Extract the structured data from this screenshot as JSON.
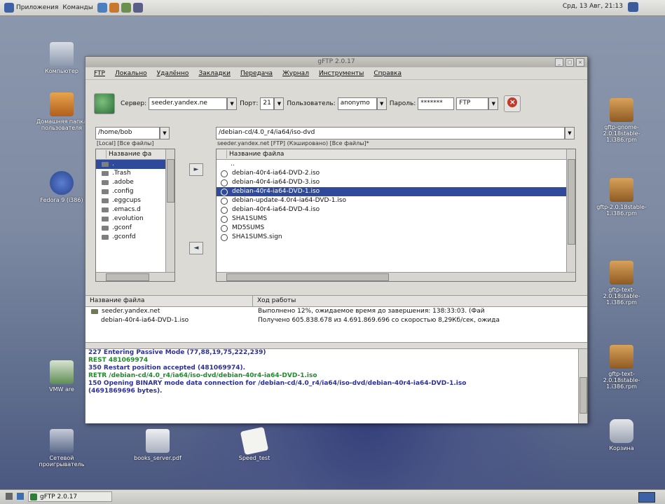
{
  "top_panel": {
    "menu_apps": "Приложения",
    "menu_commands": "Команды",
    "clock": "Срд, 13 Авг, 21:13"
  },
  "desktop_icons": {
    "computer": "Компьютер",
    "home": "Домашняя папка пользователя",
    "fedora": "Fedora 9 (i386)",
    "vmware": "VMW are",
    "network": "Сетевой проигрыватель",
    "pdf": "books_server.pdf",
    "speed": "Speed_test",
    "rpm1": "gftp-gnome-2.0.18stable-1.i386.rpm",
    "rpm2": "gftp-2.0.18stable-1.i386.rpm",
    "rpm3": "gftp-text-2.0.18stable-1.i386.rpm",
    "rpm4": "gftp-text-2.0.18stable-1.i386.rpm",
    "trash": "Корзина"
  },
  "window": {
    "title": "gFTP 2.0.17",
    "menu": [
      "FTP",
      "Локально",
      "Удалённо",
      "Закладки",
      "Передача",
      "Журнал",
      "Инструменты",
      "Справка"
    ],
    "toolbar": {
      "server_label": "Сервер:",
      "server_value": "seeder.yandex.ne",
      "port_label": "Порт:",
      "port_value": "21",
      "user_label": "Пользователь:",
      "user_value": "anonymo",
      "pass_label": "Пароль:",
      "pass_value": "*******",
      "protocol": "FTP"
    },
    "local": {
      "path": "/home/bob",
      "status": "[Local] [Все файлы]",
      "col_name": "Название фа",
      "items": [
        ".",
        ".Trash",
        ".adobe",
        ".config",
        ".eggcups",
        ".emacs.d",
        ".evolution",
        ".gconf",
        ".gconfd"
      ]
    },
    "remote": {
      "path": "/debian-cd/4.0_r4/ia64/iso-dvd",
      "status": "seeder.yandex.net [FTP] (Кэшировано) [Все файлы]*",
      "col_name": "Название файла",
      "items": [
        "..",
        "debian-40r4-ia64-DVD-2.iso",
        "debian-40r4-ia64-DVD-3.iso",
        "debian-40r4-ia64-DVD-1.iso",
        "debian-update-4.0r4-ia64-DVD-1.iso",
        "debian-40r4-ia64-DVD-4.iso",
        "SHA1SUMS",
        "MD5SUMS",
        "SHA1SUMS.sign"
      ]
    },
    "transfer": {
      "col_file": "Название файла",
      "col_progress": "Ход работы",
      "rows": [
        {
          "file": "seeder.yandex.net",
          "progress": "Выполнено 12%, ожидаемое время до завершения: 138:33:03. (Фай"
        },
        {
          "file": "debian-40r4-ia64-DVD-1.iso",
          "progress": "Получено 605.838.678 из 4.691.869.696 со скоростью 8,29Кб/сек, ожида"
        }
      ]
    },
    "log": [
      {
        "text": "227 Entering Passive Mode (77,88,19,75,222,239)",
        "color": "#2b2f9a"
      },
      {
        "text": "REST 481069974",
        "color": "#1f8a2a"
      },
      {
        "text": "350 Restart position accepted (481069974).",
        "color": "#2b2f9a"
      },
      {
        "text": "RETR /debian-cd/4.0_r4/ia64/iso-dvd/debian-40r4-ia64-DVD-1.iso",
        "color": "#1f8a2a"
      },
      {
        "text": "150 Opening BINARY mode data connection for /debian-cd/4.0_r4/ia64/iso-dvd/debian-40r4-ia64-DVD-1.iso",
        "color": "#2b2f9a"
      },
      {
        "text": "(4691869696 bytes).",
        "color": "#2b2f9a"
      }
    ]
  },
  "taskbar": {
    "task": "gFTP 2.0.17"
  }
}
